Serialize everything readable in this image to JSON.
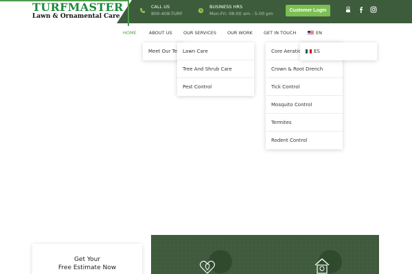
{
  "logo": {
    "main": "TURFMASTER",
    "sub": "Lawn & Ornamental Care"
  },
  "header": {
    "call_label": "CALL US",
    "call_value": "800-408-TURF",
    "hours_label": "BUSINESS HRS",
    "hours_value": "Mon-Fri: 08:00 am - 5:00 pm",
    "login_label": "Customer Login",
    "social": [
      "youtube-icon",
      "facebook-icon",
      "instagram-icon"
    ]
  },
  "nav": {
    "home": "HOME",
    "about": "ABOUT US",
    "services": "OUR SERVICES",
    "work": "OUR WORK",
    "touch": "GET IN TOUCH",
    "lang": "EN"
  },
  "menus": {
    "about": [
      "Meet Our Team"
    ],
    "services": [
      "Lawn Care",
      "Tree And Shrub Care",
      "Pest Control"
    ],
    "touch": [
      "Core Aeration",
      "Crown & Root Drench",
      "Tick Control",
      "Mosquito Control",
      "Termites",
      "Rodent Control"
    ],
    "lang": "ES"
  },
  "estimate": {
    "line1": "Get Your",
    "line2": "Free Estimate Now"
  },
  "colors": {
    "brand_green": "#3d5c3c",
    "accent": "#7bbf52",
    "logo_green": "#1d8a3a"
  }
}
